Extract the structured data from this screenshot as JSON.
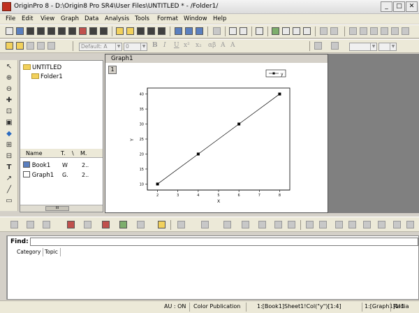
{
  "window": {
    "title": "OriginPro 8 - D:\\Origin8 Pro SR4\\User Files\\UNTITLED * - /Folder1/",
    "controls": {
      "minimize": "_",
      "maximize": "□",
      "close": "✕"
    }
  },
  "menu": [
    "File",
    "Edit",
    "View",
    "Graph",
    "Data",
    "Analysis",
    "Tools",
    "Format",
    "Window",
    "Help"
  ],
  "format_toolbar": {
    "font_name": "Default: A",
    "font_size": "0",
    "bold": "B",
    "italic": "I",
    "underline": "U",
    "superscript": "x²",
    "subscript": "x₂"
  },
  "explorer": {
    "root_folder": "UNTITLED",
    "child_folder": "Folder1",
    "columns": [
      "Name",
      "T.",
      "\\",
      "M."
    ],
    "items": [
      {
        "name": "Book1",
        "type": "W",
        "mod": "2.."
      },
      {
        "name": "Graph1",
        "type": "G.",
        "mod": "2.."
      }
    ],
    "scroll_thumb": "III"
  },
  "graph_window": {
    "title": "Graph1",
    "layer": "1",
    "legend_text": "y"
  },
  "chart_data": {
    "type": "line",
    "x": [
      2,
      4,
      6,
      8
    ],
    "y": [
      10,
      20,
      30,
      40
    ],
    "xlabel": "X",
    "ylabel": "Y",
    "xlim": [
      1.5,
      8.5
    ],
    "ylim": [
      8,
      42
    ],
    "xticks": [
      2,
      3,
      4,
      5,
      6,
      7,
      8
    ],
    "yticks": [
      10,
      15,
      20,
      25,
      30,
      35,
      40
    ],
    "marker": "square",
    "grid": false,
    "legend_placement": "top-right"
  },
  "find_panel": {
    "label": "Find:",
    "input_value": "",
    "tabs": [
      "Category",
      "Topic"
    ]
  },
  "status": {
    "au": "AU : ON",
    "theme": "Color Publication",
    "active_data": "1:[Book1]Sheet1!Col(\"y\")[1:4]",
    "active_layer": "1:[Graph1]1!1",
    "units": "Radia"
  }
}
